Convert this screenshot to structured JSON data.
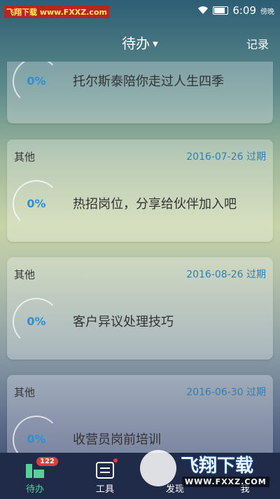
{
  "status_bar": {
    "watermark_left": "飞翔下载",
    "watermark_url": "www.FXXZ.com",
    "time": "6:09",
    "carrier": "傍晚"
  },
  "header": {
    "title": "待办",
    "right_action": "记录"
  },
  "cards": [
    {
      "category": "",
      "date": "",
      "percent": "0%",
      "title": "托尔斯泰陪你走过人生四季"
    },
    {
      "category": "其他",
      "date": "2016-07-26 过期",
      "percent": "0%",
      "title": "热招岗位，分享给伙伴加入吧"
    },
    {
      "category": "其他",
      "date": "2016-08-26 过期",
      "percent": "0%",
      "title": "客户异议处理技巧"
    },
    {
      "category": "其他",
      "date": "2016-06-30 过期",
      "percent": "0%",
      "title": "收营员岗前培训"
    }
  ],
  "tabs": [
    {
      "label": "待办",
      "badge": "122",
      "active": true
    },
    {
      "label": "工具",
      "dot": true
    },
    {
      "label": "发现"
    },
    {
      "label": "我"
    }
  ],
  "watermark_logo": {
    "main": "飞翔下载",
    "url": "WWW.FXXZ.COM"
  },
  "colors": {
    "accent": "#2f8fd1",
    "date": "#2f7fb0",
    "tab_active": "#56d19b",
    "tabbar_bg": "#1f2b48",
    "badge": "#e53a3a"
  }
}
